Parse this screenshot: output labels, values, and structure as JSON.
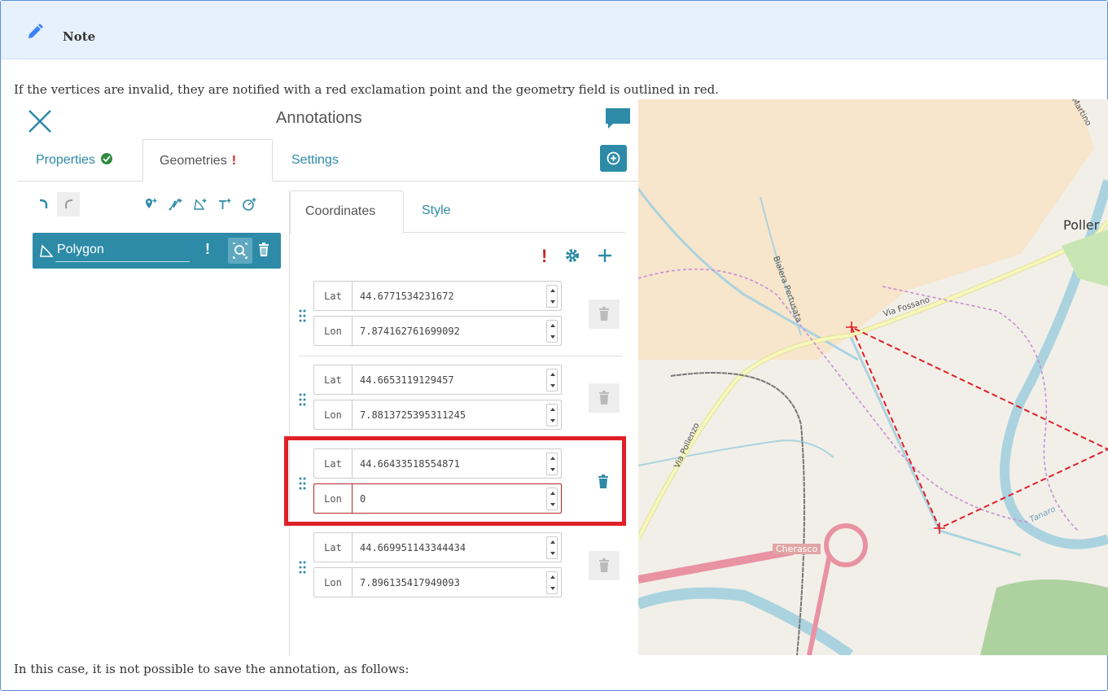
{
  "note": {
    "title": "Note",
    "intro": "If the vertices are invalid, they are notified with a red exclamation point and the geometry field is outlined in red.",
    "outro": "In this case, it is not possible to save the annotation, as follows:"
  },
  "panel": {
    "title": "Annotations",
    "tabs": [
      {
        "label": "Properties",
        "status": "valid"
      },
      {
        "label": "Geometries",
        "status": "!"
      },
      {
        "label": "Settings"
      }
    ],
    "geometry_item": {
      "label": "Polygon",
      "status": "!"
    },
    "subtabs": [
      {
        "label": "Coordinates"
      },
      {
        "label": "Style"
      }
    ],
    "coordinates_status": "!"
  },
  "coordinates": [
    {
      "lat_label": "Lat",
      "lat": "44.6771534231672",
      "lon_label": "Lon",
      "lon": "7.874162761699092"
    },
    {
      "lat_label": "Lat",
      "lat": "44.6653119129457",
      "lon_label": "Lon",
      "lon": "7.8813725395311245"
    },
    {
      "lat_label": "Lat",
      "lat": "44.66433518554871",
      "lon_label": "Lon",
      "lon": "0",
      "invalid": true
    },
    {
      "lat_label": "Lat",
      "lat": "44.669951143344434",
      "lon_label": "Lon",
      "lon": "7.896135417949093"
    }
  ],
  "map": {
    "labels": {
      "town": "Poller",
      "road": "Via Fossano",
      "canal": "Bialera Pertusata",
      "street": "Via Pollenzo",
      "river": "Tanaro",
      "city": "Cherasco",
      "top": "Martino"
    }
  },
  "colors": {
    "accent": "#2d8ba7",
    "error": "#c62828",
    "highlight_frame": "#e02027",
    "note_bg": "#e7f1fd",
    "map_bg": "#f2efe9"
  }
}
